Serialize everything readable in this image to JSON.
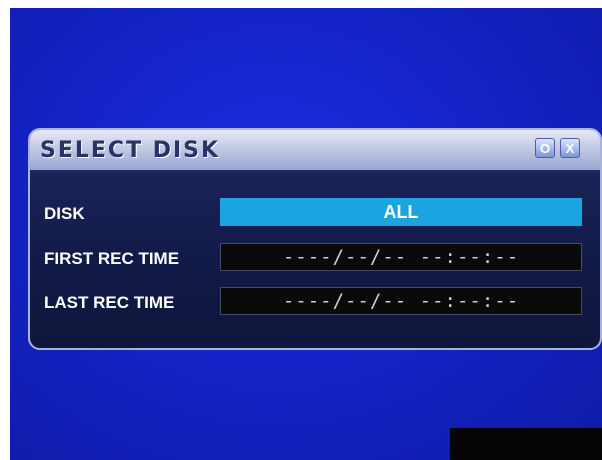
{
  "dialog": {
    "title": "SELECT DISK",
    "option_button": "O",
    "close_button": "X"
  },
  "rows": {
    "disk_label": "DISK",
    "disk_value": "ALL",
    "first_rec_label": "FIRST REC TIME",
    "first_rec_value": "----/--/--  --:--:--",
    "last_rec_label": "LAST REC TIME",
    "last_rec_value": "----/--/--  --:--:--"
  },
  "colors": {
    "screen_blue": "#1424c8",
    "field_highlight": "#1aa5e0",
    "time_field_bg": "#0a0a0a"
  }
}
